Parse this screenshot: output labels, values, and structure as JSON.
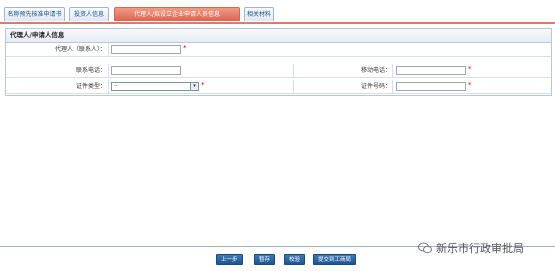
{
  "tabs": [
    {
      "label": "名称预先核准申请书",
      "active": false
    },
    {
      "label": "投资人信息",
      "active": false
    },
    {
      "label": "代理人/拟设立企业申请人员信息",
      "active": true
    },
    {
      "label": "相关材料",
      "active": false
    }
  ],
  "panel": {
    "title": "代理人/申请人信息",
    "fields": {
      "agent_label": "代理人（联系人）：",
      "phone_label": "联系电话：",
      "mobile_label": "移动电话：",
      "id_type_label": "证件类型：",
      "id_type_value": "--",
      "id_number_label": "证件号码："
    }
  },
  "buttons": {
    "prev": "上一步",
    "save": "暂存",
    "validate": "校验",
    "submit": "提交到工商局"
  },
  "watermark": "新乐市行政审批局",
  "colors": {
    "active_tab": "#d9654e",
    "button": "#1f5490"
  }
}
